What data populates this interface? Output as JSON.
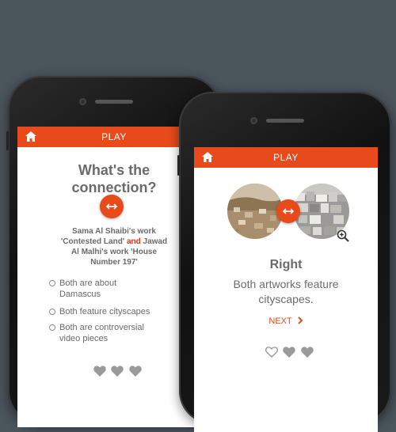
{
  "left_phone": {
    "header": {
      "title": "PLAY",
      "home_icon": "home-icon"
    },
    "question": {
      "line1": "What's the",
      "line2": "connection?"
    },
    "swap_icon": "swap-arrows-icon",
    "description": {
      "part1": "Sama Al Shaibi's work",
      "part2": "'Contested Land'",
      "and": "and",
      "part3": "Jawad",
      "part4": "Al Malhi's work 'House",
      "part5": "Number 197'"
    },
    "options": [
      {
        "line1": "Both are about",
        "line2": "Damascus"
      },
      {
        "line1": "Both feature cityscapes",
        "line2": ""
      },
      {
        "line1": "Both are controversial",
        "line2": "video pieces"
      }
    ],
    "lives": {
      "filled": 3,
      "total": 3,
      "icon": "heart-icon"
    }
  },
  "right_phone": {
    "header": {
      "title": "PLAY",
      "home_icon": "home-icon"
    },
    "result": {
      "title": "Right",
      "line1": "Both artworks feature",
      "line2": "cityscapes."
    },
    "next_label": "NEXT",
    "zoom_icon": "zoom-in-icon",
    "lives": {
      "filled": 2,
      "total": 3,
      "icon": "heart-icon"
    }
  },
  "colors": {
    "accent": "#e84a1c",
    "background": "#4a545b",
    "text": "#6b6b6b",
    "and_highlight": "#e0301e"
  }
}
